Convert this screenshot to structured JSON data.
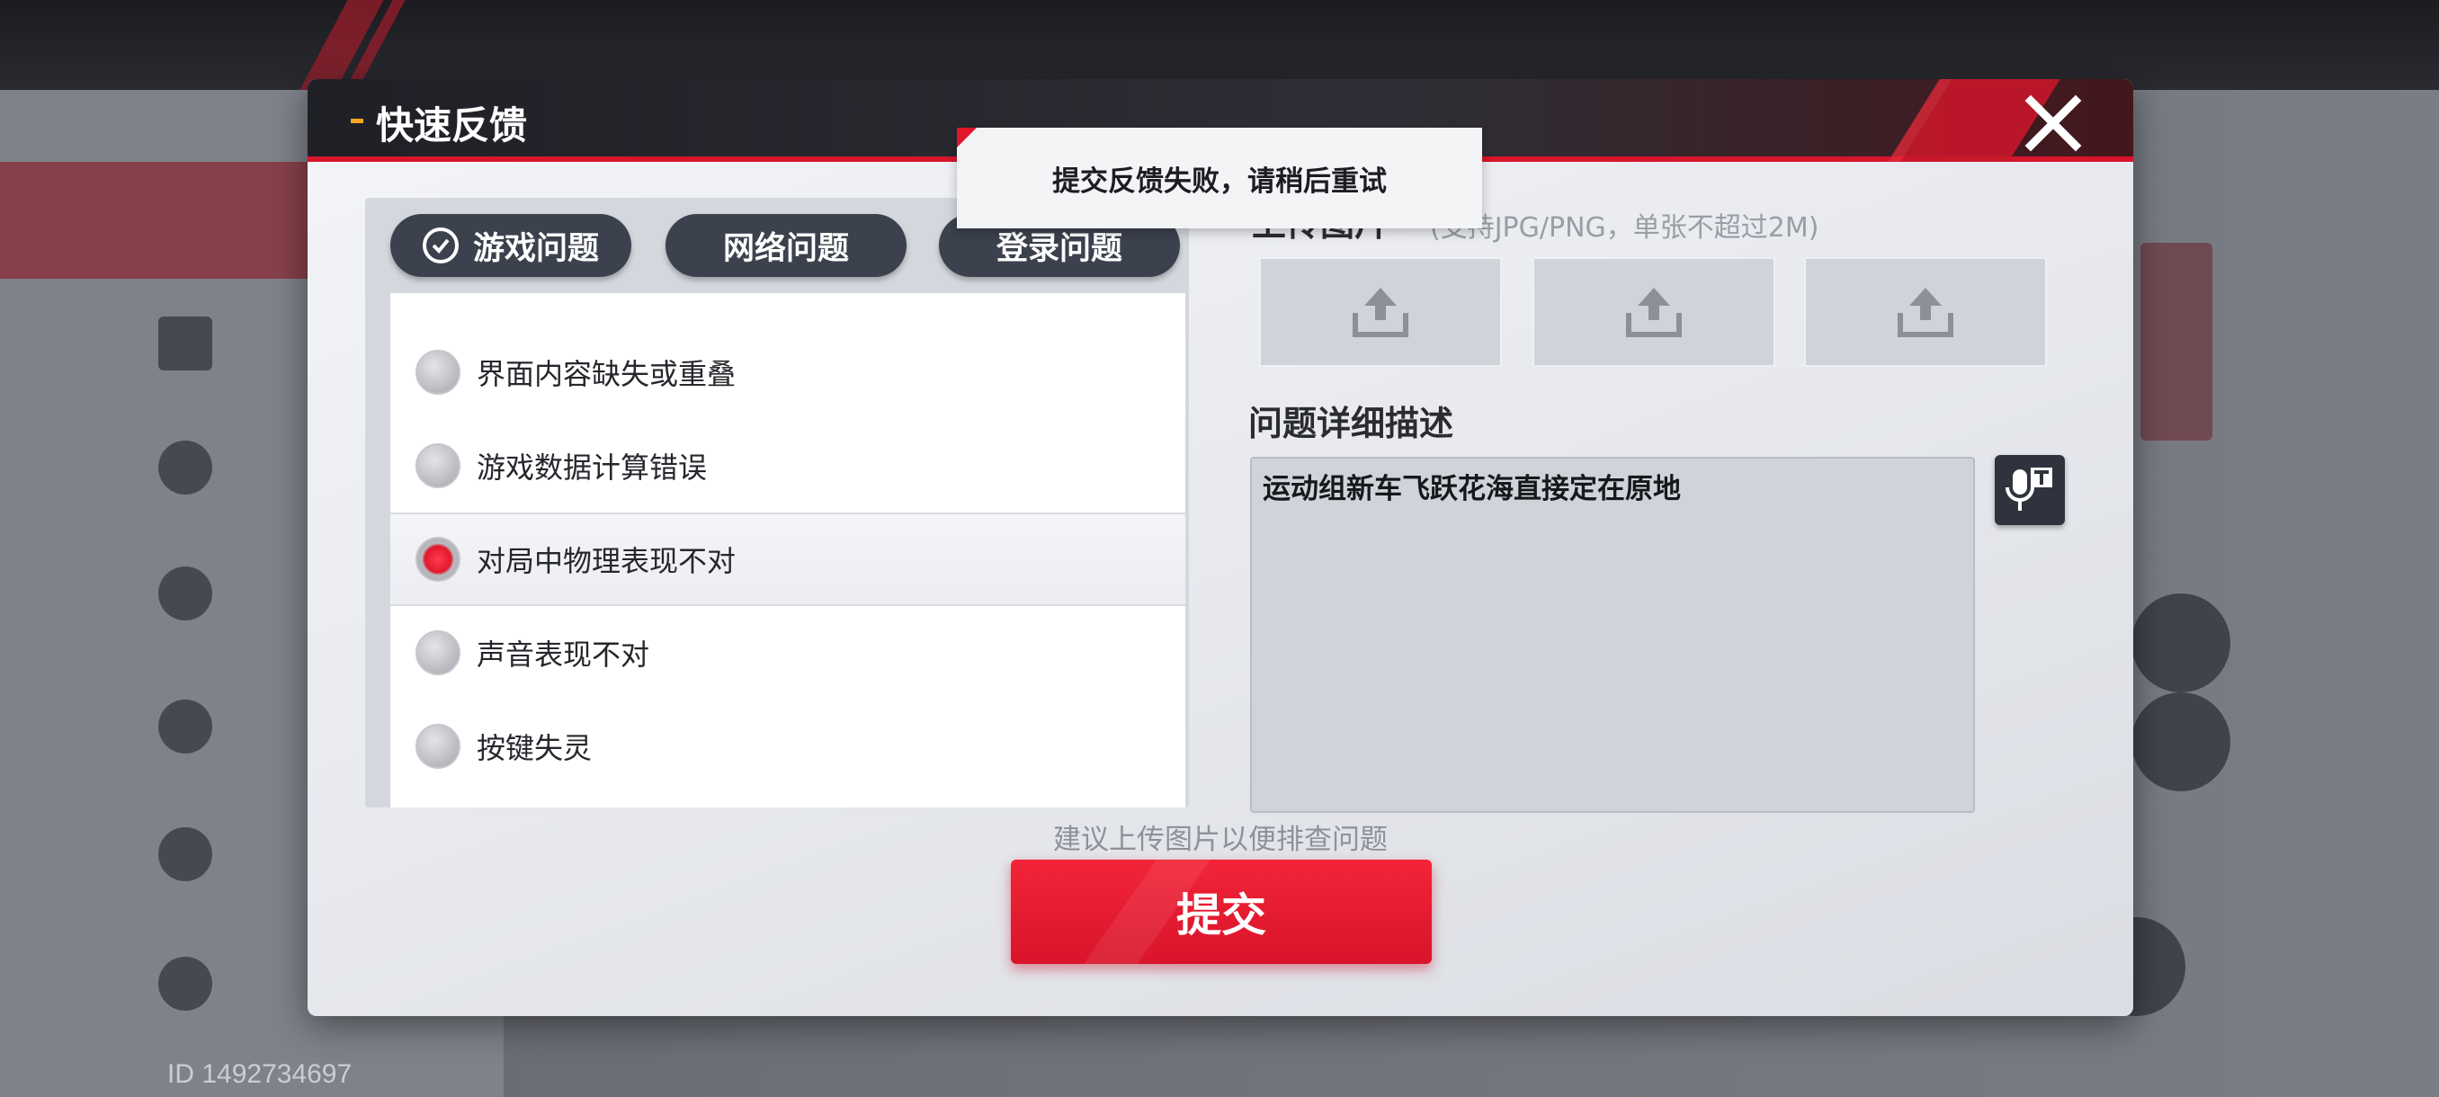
{
  "background": {
    "player_id": "ID 1492734697"
  },
  "dialog": {
    "title": "快速反馈",
    "close_icon": "close-icon"
  },
  "tabs": [
    {
      "label": "游戏问题",
      "selected": true
    },
    {
      "label": "网络问题",
      "selected": false
    },
    {
      "label": "登录问题",
      "selected": false
    }
  ],
  "issues": [
    {
      "label": "界面内容缺失或重叠",
      "selected": false
    },
    {
      "label": "游戏数据计算错误",
      "selected": false
    },
    {
      "label": "对局中物理表现不对",
      "selected": true
    },
    {
      "label": "声音表现不对",
      "selected": false
    },
    {
      "label": "按键失灵",
      "selected": false
    }
  ],
  "upload": {
    "title": "上传图片",
    "hint": "(支持JPG/PNG，单张不超过2M)",
    "slot_icon": "upload-icon"
  },
  "description": {
    "title": "问题详细描述",
    "value": "运动组新车飞跃花海直接定在原地",
    "voice_icon": "voice-input-icon"
  },
  "suggestion": "建议上传图片以便排查问题",
  "submit_label": "提交",
  "toast": "提交反馈失败，请稍后重试",
  "colors": {
    "accent_red": "#e0162b",
    "tab_bg": "#3c414e",
    "header_bg": "#1f2026"
  }
}
